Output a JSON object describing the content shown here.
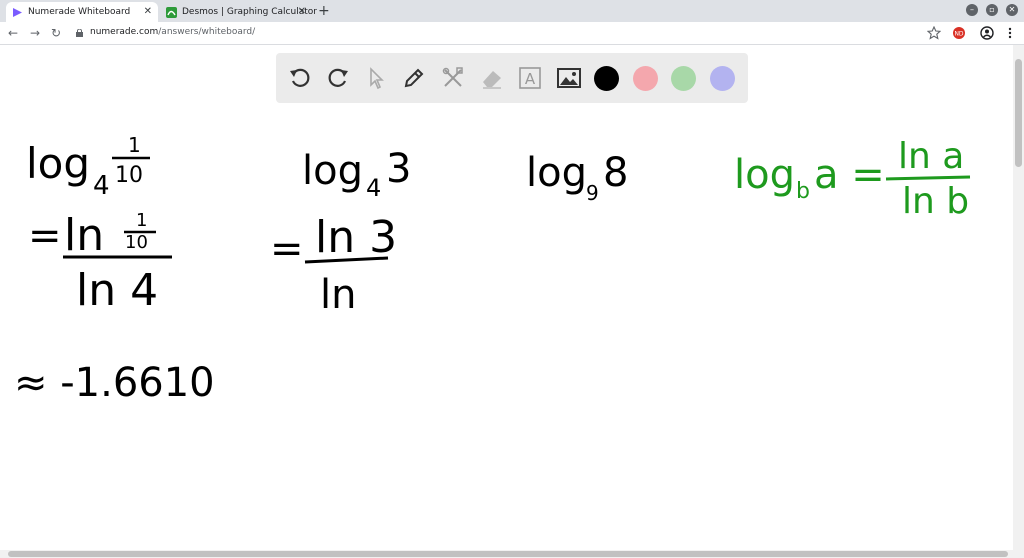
{
  "browser": {
    "tabs": [
      {
        "title": "Numerade Whiteboard",
        "active": true,
        "favicon_color": "#7b5cff"
      },
      {
        "title": "Desmos | Graphing Calculator",
        "active": false,
        "favicon_color": "#2e9b3a"
      }
    ],
    "new_tab_label": "+",
    "url_domain": "numerade.com",
    "url_path": "/answers/whiteboard/",
    "window_controls": [
      "minimize",
      "maximize",
      "close"
    ]
  },
  "toolbar": {
    "tools": [
      "undo-icon",
      "redo-icon",
      "pointer-icon",
      "pen-icon",
      "tools-icon",
      "eraser-icon",
      "text-icon",
      "image-icon"
    ],
    "colors": [
      "#000000",
      "#f4a7ad",
      "#a8d8a8",
      "#b3b3f0"
    ]
  },
  "whiteboard": {
    "ink_color": "#000000",
    "green_ink": "#1e9a1e",
    "expr1_base": "log",
    "expr1_sub": "4",
    "expr1_num": "1",
    "expr1_den": "10",
    "expr1_eq": "=",
    "expr1_ln": "ln",
    "expr1_ln_num": "1",
    "expr1_ln_den": "10",
    "expr1_bottom": "ln 4",
    "expr1_approx": "≈ -1.6610",
    "expr2_base": "log",
    "expr2_sub": "4",
    "expr2_arg": "3",
    "expr2_eq": "=",
    "expr2_top": "ln 3",
    "expr2_bottom": "ln",
    "expr3_base": "log",
    "expr3_sub": "9",
    "expr3_arg": "8",
    "formula_left": "log",
    "formula_sub": "b",
    "formula_arg": "a =",
    "formula_top": "ln a",
    "formula_bottom": "ln b"
  }
}
